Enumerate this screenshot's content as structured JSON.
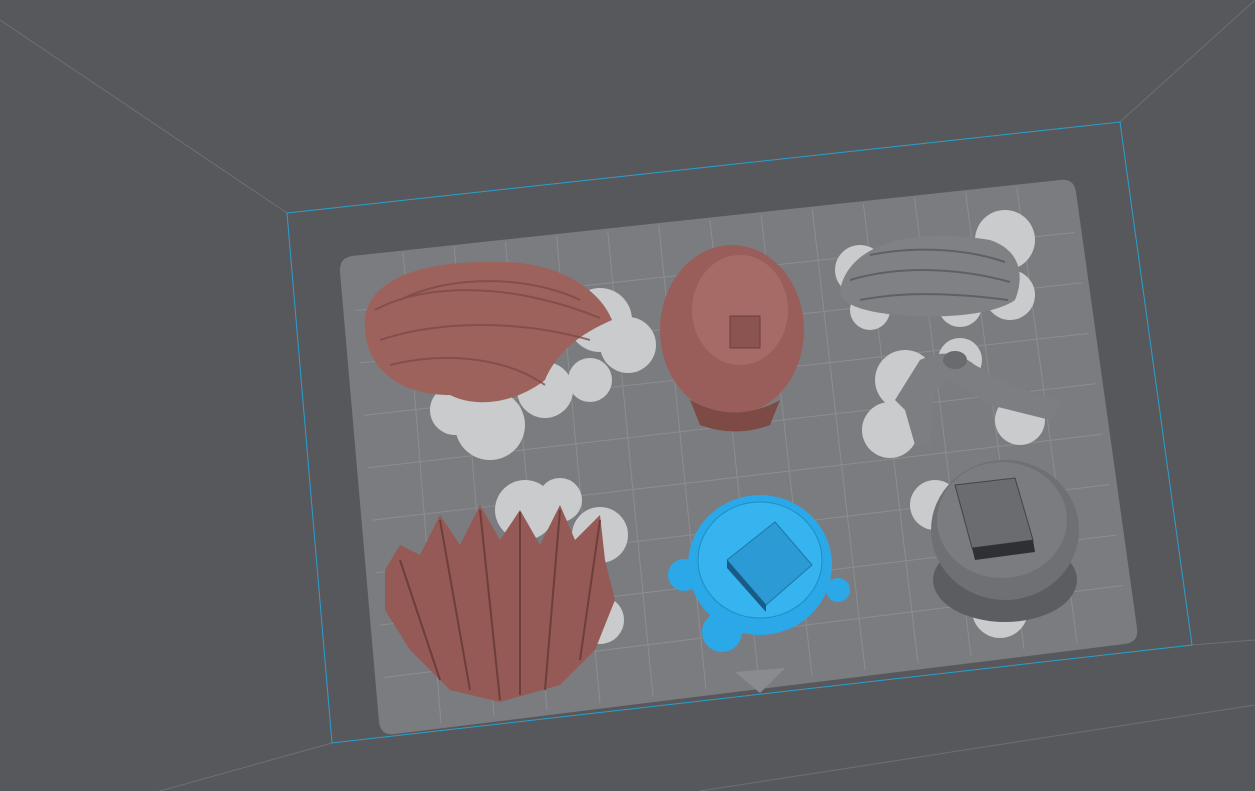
{
  "viewport": {
    "background_color": "#57585c",
    "plate_color": "#7b7c80",
    "grid_color": "#8c8d91",
    "bounds_color": "#2a9fd0",
    "support_halo_color": "#c9cbcc"
  },
  "objects": [
    {
      "name": "hair-long",
      "color": "#9e625d",
      "selected": false
    },
    {
      "name": "helmet-head",
      "color": "#9a5e5a",
      "selected": false
    },
    {
      "name": "hair-grey",
      "color": "#808184",
      "selected": false
    },
    {
      "name": "grey-bracket-part",
      "color": "#7d7e81",
      "selected": false
    },
    {
      "name": "hair-spiky",
      "color": "#955a55",
      "selected": false
    },
    {
      "name": "blue-base-part",
      "color": "#2ba8e8",
      "selected": true
    },
    {
      "name": "grey-round-base",
      "color": "#6f7073",
      "selected": false
    }
  ]
}
